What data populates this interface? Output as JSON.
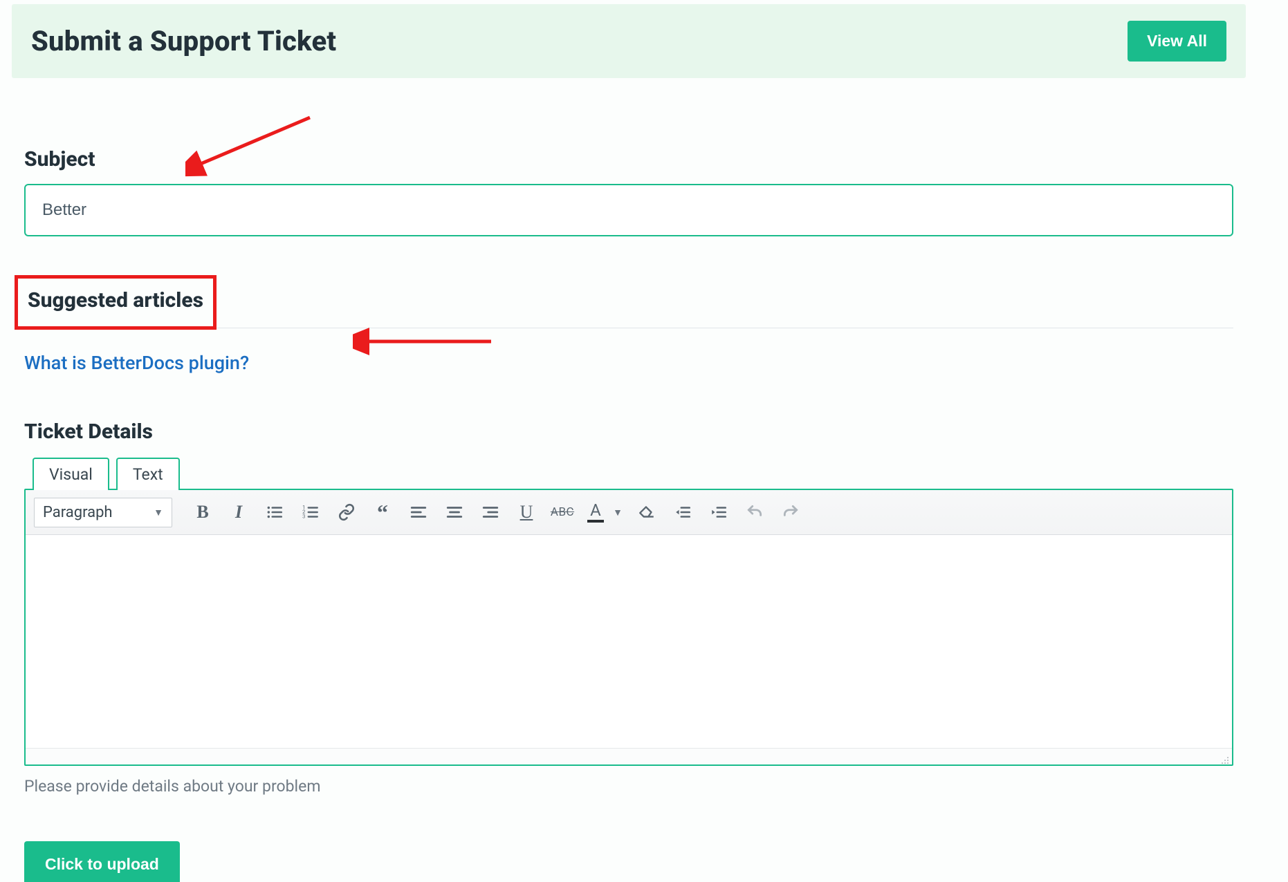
{
  "header": {
    "title": "Submit a Support Ticket",
    "view_all_label": "View All"
  },
  "subject": {
    "label": "Subject",
    "value": "Better"
  },
  "suggested": {
    "heading": "Suggested articles",
    "items": [
      {
        "label": "What is BetterDocs plugin?"
      }
    ]
  },
  "details": {
    "label": "Ticket Details",
    "tabs": {
      "visual": "Visual",
      "text": "Text"
    },
    "toolbar": {
      "format_selected": "Paragraph"
    },
    "helper": "Please provide details about your problem"
  },
  "upload": {
    "label": "Click to upload"
  },
  "colors": {
    "accent": "#1abc8c",
    "annotation": "#ea1c1c",
    "link": "#1b6ec2"
  }
}
